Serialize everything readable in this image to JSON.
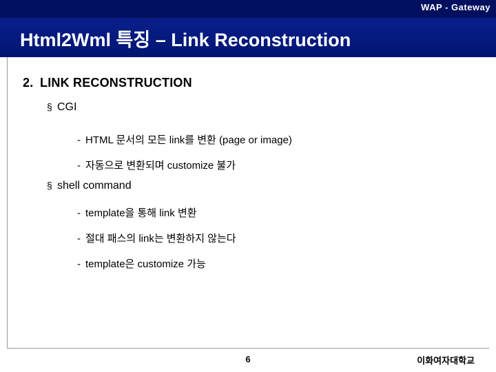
{
  "header": {
    "label": "WAP - Gateway"
  },
  "title": {
    "text": "Html2Wml 특징 – Link Reconstruction"
  },
  "body": {
    "section": {
      "number": "2.",
      "heading": "LINK RECONSTRUCTION"
    },
    "bullets": [
      {
        "marker": "§",
        "label": "CGI",
        "sub": [
          {
            "dash": "-",
            "text": "HTML 문서의 모든 link를 변환 (page or image)"
          },
          {
            "dash": "-",
            "text": "자동으로 변환되며 customize 불가"
          }
        ]
      },
      {
        "marker": "§",
        "label": "shell command",
        "sub": [
          {
            "dash": "-",
            "text": "template을 통해 link 변환"
          },
          {
            "dash": "-",
            "text": "절대 패스의 link는 변환하지 않는다"
          },
          {
            "dash": "-",
            "text": "template은 customize 가능"
          }
        ]
      }
    ]
  },
  "footer": {
    "page_number": "6",
    "organization": "이화여자대학교"
  },
  "colors": {
    "header_band": "#000f5e",
    "title_band": "#001a86",
    "title_text": "#ffffff",
    "rule": "#9a9a9a"
  }
}
